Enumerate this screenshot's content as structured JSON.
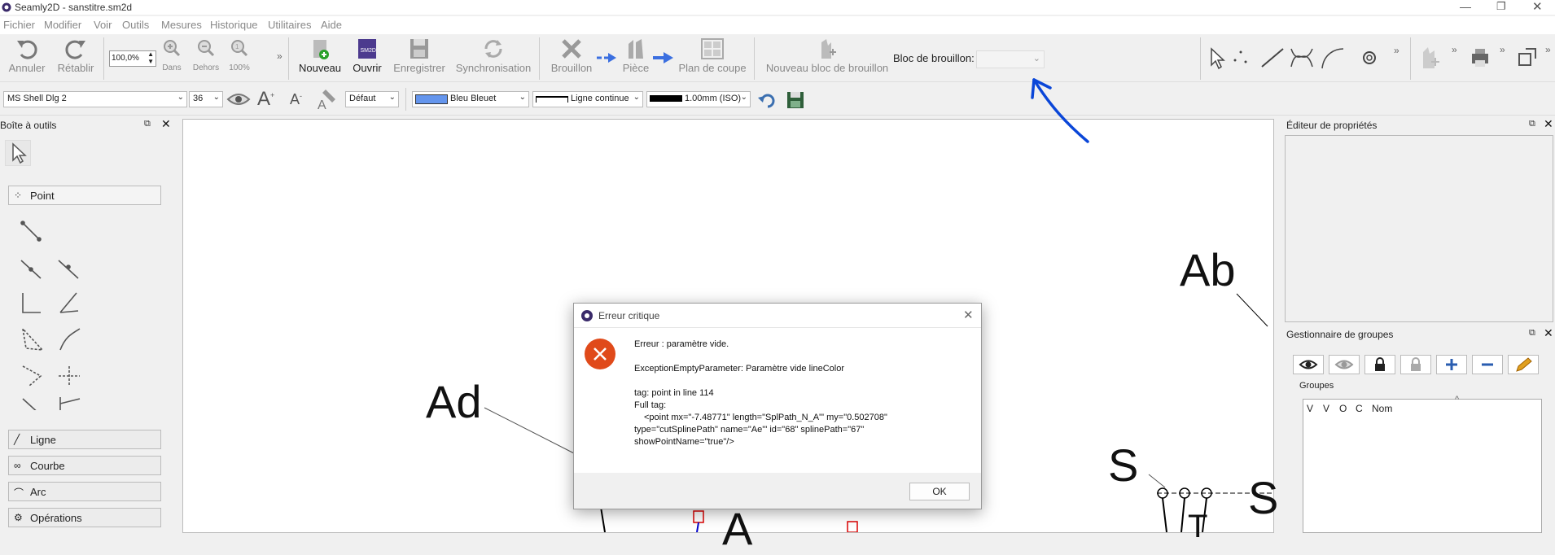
{
  "window": {
    "title": "Seamly2D - sanstitre.sm2d"
  },
  "menu": [
    "Fichier",
    "Modifier",
    "Voir",
    "Outils",
    "Mesures",
    "Historique",
    "Utilitaires",
    "Aide"
  ],
  "toolbar": {
    "undo": "Annuler",
    "redo": "Rétablir",
    "zoom_value": "100,0%",
    "zoom_in": "Dans",
    "zoom_out": "Dehors",
    "zoom_100": "100%",
    "new": "Nouveau",
    "open": "Ouvrir",
    "open_badge": "SM2D",
    "save": "Enregistrer",
    "sync": "Synchronisation",
    "draft": "Brouillon",
    "piece": "Pièce",
    "layout": "Plan de coupe",
    "new_draft_block": "Nouveau bloc de brouillon",
    "draft_block_label": "Bloc de brouillon:",
    "overflow": "»"
  },
  "toolbar2": {
    "font": "MS Shell Dlg 2",
    "font_size": "36",
    "point_style": "Défaut",
    "color": "Bleu Bleuet",
    "color_hex": "#6495ED",
    "line_type": "Ligne continue",
    "line_weight": "1.00mm (ISO)"
  },
  "toolbox": {
    "title": "Boîte à outils",
    "groups": [
      "Point",
      "Ligne",
      "Courbe",
      "Arc",
      "Opérations"
    ]
  },
  "canvas": {
    "labels": [
      "Ab",
      "Ad",
      "S",
      "S",
      "A",
      "T"
    ]
  },
  "properties": {
    "title": "Éditeur de propriétés"
  },
  "groups_manager": {
    "title": "Gestionnaire de groupes",
    "groups_label": "Groupes",
    "columns": [
      "V",
      "V",
      "O",
      "C",
      "Nom"
    ]
  },
  "dialog": {
    "title": "Erreur critique",
    "line1": "Erreur : paramètre vide.",
    "line2": "ExceptionEmptyParameter: Paramètre vide lineColor",
    "line3": "tag: point in line 114",
    "line4": "Full tag:",
    "line5": "<point mx=\"-7.48771\" length=\"SplPath_N_A'\" my=\"0.502708\"",
    "line6": "type=\"cutSplinePath\" name=\"Ae'\" id=\"68\" splinePath=\"67\"",
    "line7": "showPointName=\"true\"/>",
    "ok": "OK"
  },
  "colors": {
    "accent": "#0b57d0",
    "error": "#e04a1a",
    "annotation": "#0a46d8"
  }
}
